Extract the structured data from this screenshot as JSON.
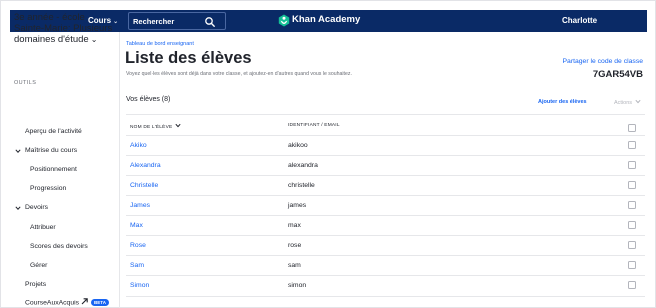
{
  "topnav": {
    "courses_label": "Cours",
    "courses_caret": "⌄",
    "search_label": "Rechercher",
    "brand": "Khan Academy",
    "user": "Charlotte"
  },
  "sidebar": {
    "class_name": "3e année - école Sainte-Marie: Plusieurs domaines d'étude",
    "class_chevron": "⌄",
    "tools_label": "OUTILS",
    "items": [
      {
        "label": "Aperçu de l'activité"
      },
      {
        "label": "Maîtrise du cours",
        "expanded": true
      },
      {
        "label": "Positionnement"
      },
      {
        "label": "Progression"
      },
      {
        "label": "Devoirs",
        "expanded": true
      },
      {
        "label": "Attribuer"
      },
      {
        "label": "Scores des devoirs"
      },
      {
        "label": "Gérer"
      },
      {
        "label": "Projets"
      },
      {
        "label": "CourseAuxAcquis",
        "badge": "BETA"
      }
    ]
  },
  "main": {
    "breadcrumb": "Tableau de bord enseignant",
    "title": "Liste des élèves",
    "subtitle": "Voyez quel·les élèves sont déjà dans votre classe, et ajoutez-en d'autres quand vous le souhaitez.",
    "share_label": "Partager le code de classe",
    "class_code": "7GAR54VB",
    "students_count": "Vos élèves (8)",
    "add_students": "Ajouter des élèves",
    "actions": "Actions",
    "table": {
      "col_name": "NOM DE L'ÉLÈVE",
      "col_id": "IDENTIFIANT / EMAIL",
      "rows": [
        {
          "name": "Akiko",
          "id": "akikoo"
        },
        {
          "name": "Alexandra",
          "id": "alexandra"
        },
        {
          "name": "Christelle",
          "id": "christelle"
        },
        {
          "name": "James",
          "id": "james"
        },
        {
          "name": "Max",
          "id": "max"
        },
        {
          "name": "Rose",
          "id": "rose"
        },
        {
          "name": "Sam",
          "id": "sam"
        },
        {
          "name": "Simon",
          "id": "simon"
        }
      ]
    }
  },
  "colors": {
    "nav_bg": "#0a2a66",
    "accent": "#1865f2",
    "brand_leaf": "#14bf96",
    "text": "#21242c",
    "muted": "#6b6e76"
  },
  "icons": {
    "search": "search-icon",
    "logo": "khan-academy-logo-icon",
    "external": "external-link-icon",
    "chevron": "chevron-down-icon"
  }
}
